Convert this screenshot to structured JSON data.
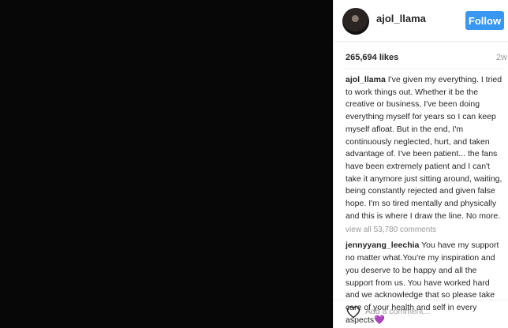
{
  "post": {
    "username": "ajol_llama",
    "follow_label": "Follow",
    "likes": "265,694 likes",
    "age": "2w",
    "caption_user": "ajol_llama",
    "caption_text": " I've given my everything. I tried to work things out. Whether it be the creative or business, I've been doing everything myself for years so I can keep myself afloat. But in the end, I'm continuously neglected, hurt, and taken advantage of. I've been patient... the fans have been extremely patient and I can't take it anymore just sitting around, waiting, being constantly rejected and given false hope. I'm so tired mentally and physically and this is where I draw the line. No more.",
    "view_all": "view all 53,780 comments",
    "comment_user": "jennyyang_leechia",
    "comment_text": " You have my support no matter what.You're my inspiration and you deserve to be happy and all the support from us. You have worked hard and we acknowledge that so please take care of your health and self in every aspects",
    "comment_emoji": "💜",
    "add_comment_placeholder": "Add a comment..."
  },
  "colors": {
    "follow_button": "#3897f0",
    "media_background": "#070707"
  },
  "icons": {
    "like": "heart-outline-icon"
  }
}
